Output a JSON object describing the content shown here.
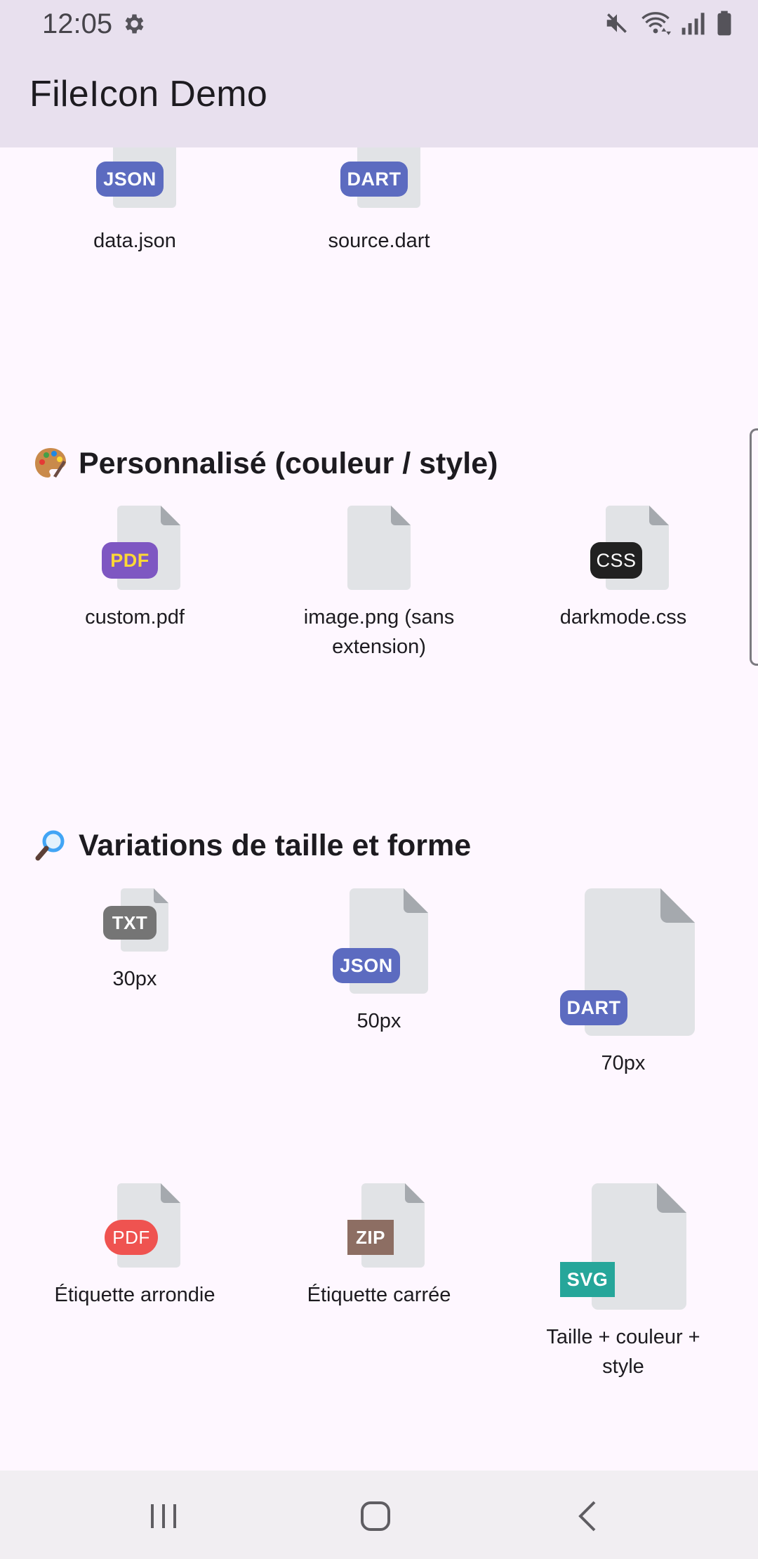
{
  "status_bar": {
    "time": "12:05",
    "icons": [
      "settings-gear-icon",
      "mute-icon",
      "wifi-icon",
      "signal-icon",
      "battery-icon"
    ]
  },
  "app_bar": {
    "title": "FileIcon Demo"
  },
  "top_row": [
    {
      "label": "data.json",
      "badge": "JSON",
      "badge_color": "#5c6bc0"
    },
    {
      "label": "source.dart",
      "badge": "DART",
      "badge_color": "#5c6bc0"
    }
  ],
  "sections": {
    "custom": {
      "emoji": "palette-icon",
      "title": "Personnalisé (couleur / style)",
      "items": [
        {
          "label": "custom.pdf",
          "badge": "PDF",
          "badge_color": "#7e57c2",
          "badge_text_color": "#fdd835"
        },
        {
          "label": "image.png (sans extension)",
          "badge": "",
          "badge_color": ""
        },
        {
          "label": "darkmode.css",
          "badge": "CSS",
          "badge_color": "#212121",
          "badge_text_color": "#ffffff"
        }
      ]
    },
    "sizes": {
      "emoji": "magnifier-icon",
      "title": "Variations de taille et forme",
      "items": [
        {
          "label": "30px",
          "badge": "TXT",
          "badge_color": "#757575"
        },
        {
          "label": "50px",
          "badge": "JSON",
          "badge_color": "#5c6bc0"
        },
        {
          "label": "70px",
          "badge": "DART",
          "badge_color": "#5c6bc0"
        }
      ],
      "items2": [
        {
          "label": "Étiquette arrondie",
          "badge": "PDF",
          "badge_color": "#ef5350"
        },
        {
          "label": "Étiquette carrée",
          "badge": "ZIP",
          "badge_color": "#8d6e63"
        },
        {
          "label": "Taille + couleur + style",
          "badge": "SVG",
          "badge_color": "#26a69a"
        }
      ]
    }
  },
  "nav_bar": {
    "buttons": [
      "recents-button",
      "home-button",
      "back-button"
    ]
  }
}
